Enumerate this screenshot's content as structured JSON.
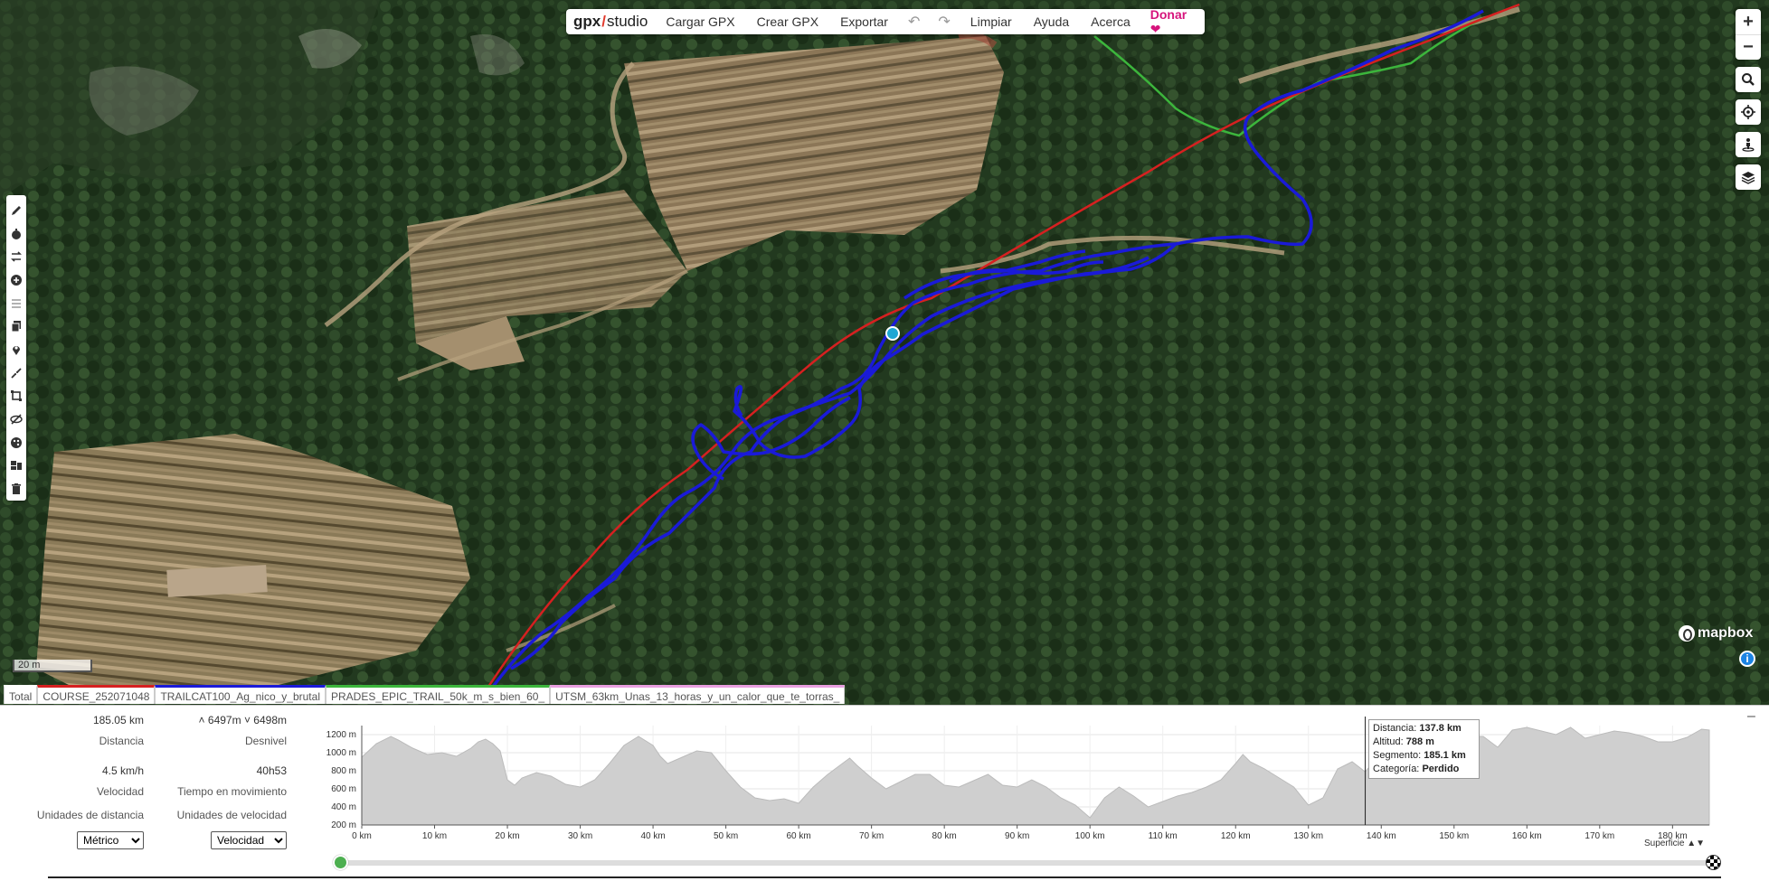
{
  "app": {
    "logo_gpx": "gpx",
    "logo_studio": "studio"
  },
  "menu": {
    "load": "Cargar GPX",
    "create": "Crear GPX",
    "export": "Exportar",
    "undo_icon": "undo-icon",
    "redo_icon": "redo-icon",
    "clear": "Limpiar",
    "help": "Ayuda",
    "about": "Acerca",
    "donate": "Donar",
    "donate_icon": "heart-icon",
    "donate_color": "#d6147c"
  },
  "left_tools": [
    "pencil-icon",
    "stopwatch-icon",
    "reverse-icon",
    "plus-circle-icon",
    "list-icon",
    "copy-icon",
    "map-pin-icon",
    "compress-icon",
    "crop-icon",
    "hide-icon",
    "palette-icon",
    "layers-edit-icon",
    "trash-icon"
  ],
  "right_controls": {
    "zoom_in": "+",
    "zoom_out": "−"
  },
  "map": {
    "scale": "20 m",
    "attribution": "mapbox",
    "info": "i",
    "track_colors": {
      "main": "#1a1ad8",
      "route": "#d62020",
      "alt": "#3cb53c"
    }
  },
  "file_tabs": [
    {
      "label": "Total",
      "color": ""
    },
    {
      "label": "COURSE_252071048",
      "color": "#d62020"
    },
    {
      "label": "TRAILCAT100_Ag_nico_y_brutal",
      "color": "#1a1ad8"
    },
    {
      "label": "PRADES_EPIC_TRAIL_50k_m_s_bien_60_",
      "color": "#3cb53c"
    },
    {
      "label": "UTSM_63km_Unas_13_horas_y_un_calor_que_te_torras_",
      "color": "#e9a0e0"
    }
  ],
  "stats": {
    "distance": "185.05 km",
    "distance_label": "Distancia",
    "elevation_up": "6497m",
    "elevation_down": "6498m",
    "elevation_label": "Desnivel",
    "speed": "4.5 km/h",
    "speed_label": "Velocidad",
    "moving_time": "40h53",
    "moving_time_label": "Tiempo en movimiento",
    "distance_units_label": "Unidades de distancia",
    "speed_units_label": "Unidades de velocidad",
    "distance_units_value": "Métrico",
    "speed_units_value": "Velocidad"
  },
  "tooltip": {
    "distance_label": "Distancia:",
    "distance": "137.8 km",
    "altitude_label": "Altitud:",
    "altitude": "788 m",
    "segment_label": "Segmento:",
    "segment": "185.1 km",
    "category_label": "Categoría:",
    "category": "Perdido"
  },
  "surface_label": "Superficie",
  "chart_data": {
    "type": "area",
    "x_unit": "km",
    "y_unit": "m",
    "xlim": [
      0,
      185.05
    ],
    "ylim": [
      200,
      1300
    ],
    "x_ticks": [
      "0 km",
      "10 km",
      "20 km",
      "30 km",
      "40 km",
      "50 km",
      "60 km",
      "70 km",
      "80 km",
      "90 km",
      "100 km",
      "110 km",
      "120 km",
      "130 km",
      "140 km",
      "150 km",
      "160 km",
      "170 km",
      "180 km"
    ],
    "y_ticks": [
      "200 m",
      "400 m",
      "600 m",
      "800 m",
      "1000 m",
      "1200 m"
    ],
    "grid": true,
    "cursor_x": 137.8,
    "x": [
      0,
      2,
      4,
      5,
      7,
      9,
      11,
      13,
      15,
      16,
      17,
      18,
      19,
      20,
      21,
      22,
      24,
      26,
      28,
      30,
      32,
      34,
      36,
      38,
      40,
      41,
      42,
      44,
      46,
      48,
      50,
      52,
      54,
      56,
      58,
      60,
      62,
      64,
      66,
      67,
      68,
      70,
      72,
      74,
      76,
      78,
      80,
      82,
      84,
      86,
      88,
      90,
      92,
      94,
      96,
      98,
      100,
      102,
      104,
      106,
      108,
      110,
      112,
      114,
      116,
      118,
      120,
      121,
      122,
      124,
      126,
      128,
      130,
      132,
      134,
      136,
      137.8,
      140,
      142,
      144,
      146,
      148,
      150,
      152,
      154,
      156,
      158,
      160,
      162,
      164,
      166,
      168,
      170,
      172,
      174,
      176,
      178,
      180,
      182,
      184,
      185.05
    ],
    "y": [
      950,
      1100,
      1180,
      1140,
      1050,
      980,
      1000,
      960,
      1050,
      1120,
      1150,
      1100,
      1020,
      700,
      640,
      720,
      780,
      740,
      650,
      620,
      700,
      880,
      1080,
      1180,
      1080,
      960,
      880,
      950,
      1020,
      1000,
      800,
      620,
      500,
      470,
      490,
      440,
      620,
      760,
      880,
      940,
      860,
      720,
      600,
      680,
      760,
      760,
      640,
      620,
      690,
      760,
      640,
      620,
      700,
      620,
      500,
      420,
      280,
      500,
      620,
      520,
      400,
      460,
      520,
      560,
      620,
      700,
      880,
      980,
      900,
      820,
      720,
      620,
      420,
      500,
      820,
      900,
      788,
      1000,
      1160,
      1210,
      1040,
      980,
      1080,
      1180,
      1180,
      1060,
      1250,
      1280,
      1240,
      1200,
      1280,
      1160,
      1200,
      1240,
      1220,
      1180,
      1120,
      1120,
      1170,
      1260,
      1250
    ]
  }
}
